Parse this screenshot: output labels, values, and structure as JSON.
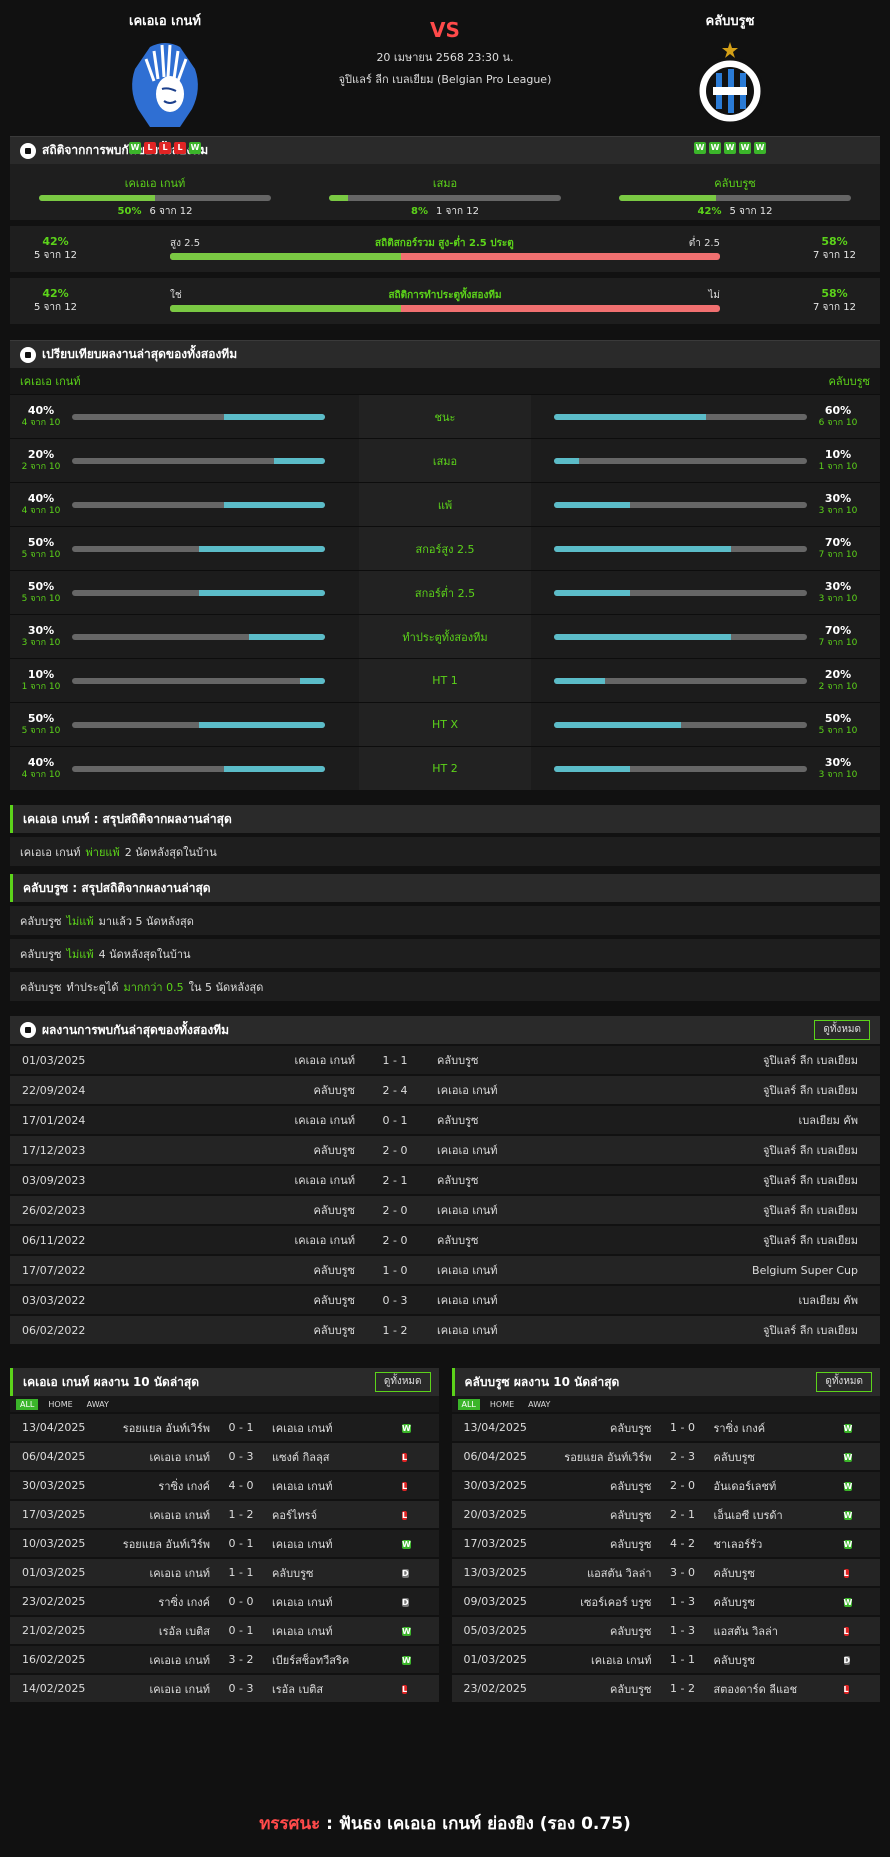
{
  "match": {
    "home": "เคเอเอ เกนท์",
    "away": "คลับบรูซ",
    "vs": "VS",
    "datetime": "20 เมษายน 2568 23:30 น.",
    "league": "จูปิแลร์ ลีก เบลเยียม (Belgian Pro League)",
    "home_form": [
      "W",
      "L",
      "L",
      "L",
      "W"
    ],
    "away_form": [
      "W",
      "W",
      "W",
      "W",
      "W"
    ]
  },
  "h2h_summary": {
    "title": "สถิติจากการพบกันของทั้งสองทีม",
    "items": [
      {
        "label": "เคเอเอ เกนท์",
        "pct": "50%",
        "count": "6 จาก 12",
        "fraction": 0.5
      },
      {
        "label": "เสมอ",
        "pct": "8%",
        "count": "1 จาก 12",
        "fraction": 0.08
      },
      {
        "label": "คลับบรูซ",
        "pct": "42%",
        "count": "5 จาก 12",
        "fraction": 0.42
      }
    ],
    "ou": {
      "left_pct": "42%",
      "left_count": "5 จาก 12",
      "over": "สูง 2.5",
      "title": "สถิติสกอร์รวม สูง-ต่ำ 2.5 ประตู",
      "under": "ต่ำ 2.5",
      "right_pct": "58%",
      "right_count": "7 จาก 12",
      "fraction": 0.42
    },
    "btts": {
      "left_pct": "42%",
      "left_count": "5 จาก 12",
      "yes": "ใช่",
      "title": "สถิติการทำประตูทั้งสองทีม",
      "no": "ไม่",
      "right_pct": "58%",
      "right_count": "7 จาก 12",
      "fraction": 0.42
    }
  },
  "compare": {
    "title": "เปรียบเทียบผลงานล่าสุดของทั้งสองทีม",
    "home": "เคเอเอ เกนท์",
    "away": "คลับบรูซ",
    "rows": [
      {
        "label": "ชนะ",
        "h_pct": "40%",
        "h_count": "4 จาก 10",
        "h": 0.4,
        "a_pct": "60%",
        "a_count": "6 จาก 10",
        "a": 0.6
      },
      {
        "label": "เสมอ",
        "h_pct": "20%",
        "h_count": "2 จาก 10",
        "h": 0.2,
        "a_pct": "10%",
        "a_count": "1 จาก 10",
        "a": 0.1
      },
      {
        "label": "แพ้",
        "h_pct": "40%",
        "h_count": "4 จาก 10",
        "h": 0.4,
        "a_pct": "30%",
        "a_count": "3 จาก 10",
        "a": 0.3
      },
      {
        "label": "สกอร์สูง 2.5",
        "h_pct": "50%",
        "h_count": "5 จาก 10",
        "h": 0.5,
        "a_pct": "70%",
        "a_count": "7 จาก 10",
        "a": 0.7
      },
      {
        "label": "สกอร์ต่ำ 2.5",
        "h_pct": "50%",
        "h_count": "5 จาก 10",
        "h": 0.5,
        "a_pct": "30%",
        "a_count": "3 จาก 10",
        "a": 0.3
      },
      {
        "label": "ทำประตูทั้งสองทีม",
        "h_pct": "30%",
        "h_count": "3 จาก 10",
        "h": 0.3,
        "a_pct": "70%",
        "a_count": "7 จาก 10",
        "a": 0.7
      },
      {
        "label": "HT 1",
        "h_pct": "10%",
        "h_count": "1 จาก 10",
        "h": 0.1,
        "a_pct": "20%",
        "a_count": "2 จาก 10",
        "a": 0.2
      },
      {
        "label": "HT X",
        "h_pct": "50%",
        "h_count": "5 จาก 10",
        "h": 0.5,
        "a_pct": "50%",
        "a_count": "5 จาก 10",
        "a": 0.5
      },
      {
        "label": "HT 2",
        "h_pct": "40%",
        "h_count": "4 จาก 10",
        "h": 0.4,
        "a_pct": "30%",
        "a_count": "3 จาก 10",
        "a": 0.3
      }
    ]
  },
  "home_summary": {
    "title": "เคเอเอ เกนท์ : สรุปสถิติจากผลงานล่าสุด",
    "lines": [
      {
        "team": "เคเอเอ เกนท์",
        "hl": "พ่ายแพ้",
        "rest": "2  นัดหลังสุดในบ้าน"
      }
    ]
  },
  "away_summary": {
    "title": "คลับบรูซ : สรุปสถิติจากผลงานล่าสุด",
    "lines": [
      {
        "team": "คลับบรูซ",
        "hl": "ไม่แพ้",
        "rest": "มาแล้ว 5 นัดหลังสุด"
      },
      {
        "team": "คลับบรูซ",
        "hl": "ไม่แพ้",
        "rest": "4  นัดหลังสุดในบ้าน"
      }
    ],
    "extra": {
      "team": "คลับบรูซ",
      "pre": "ทำประตูได้",
      "hl": "มากกว่า  0.5",
      "rest": "ใน 5 นัดหลังสุด"
    }
  },
  "h2h_list": {
    "title": "ผลงานการพบกันล่าสุดของทั้งสองทีม",
    "button": "ดูทั้งหมด",
    "rows": [
      {
        "date": "01/03/2025",
        "home": "เคเอเอ เกนท์",
        "score": "1 - 1",
        "away": "คลับบรูซ",
        "comp": "จูปิแลร์ ลีก เบลเยียม"
      },
      {
        "date": "22/09/2024",
        "home": "คลับบรูซ",
        "score": "2 - 4",
        "away": "เคเอเอ เกนท์",
        "comp": "จูปิแลร์ ลีก เบลเยียม"
      },
      {
        "date": "17/01/2024",
        "home": "เคเอเอ เกนท์",
        "score": "0 - 1",
        "away": "คลับบรูซ",
        "comp": "เบลเยียม คัพ"
      },
      {
        "date": "17/12/2023",
        "home": "คลับบรูซ",
        "score": "2 - 0",
        "away": "เคเอเอ เกนท์",
        "comp": "จูปิแลร์ ลีก เบลเยียม"
      },
      {
        "date": "03/09/2023",
        "home": "เคเอเอ เกนท์",
        "score": "2 - 1",
        "away": "คลับบรูซ",
        "comp": "จูปิแลร์ ลีก เบลเยียม"
      },
      {
        "date": "26/02/2023",
        "home": "คลับบรูซ",
        "score": "2 - 0",
        "away": "เคเอเอ เกนท์",
        "comp": "จูปิแลร์ ลีก เบลเยียม"
      },
      {
        "date": "06/11/2022",
        "home": "เคเอเอ เกนท์",
        "score": "2 - 0",
        "away": "คลับบรูซ",
        "comp": "จูปิแลร์ ลีก เบลเยียม"
      },
      {
        "date": "17/07/2022",
        "home": "คลับบรูซ",
        "score": "1 - 0",
        "away": "เคเอเอ เกนท์",
        "comp": "Belgium Super Cup"
      },
      {
        "date": "03/03/2022",
        "home": "คลับบรูซ",
        "score": "0 - 3",
        "away": "เคเอเอ เกนท์",
        "comp": "เบลเยียม คัพ"
      },
      {
        "date": "06/02/2022",
        "home": "คลับบรูซ",
        "score": "1 - 2",
        "away": "เคเอเอ เกนท์",
        "comp": "จูปิแลร์ ลีก เบลเยียม"
      }
    ]
  },
  "last10": {
    "tabs": [
      "ALL",
      "HOME",
      "AWAY"
    ],
    "button": "ดูทั้งหมด",
    "home": {
      "title": "เคเอเอ เกนท์ ผลงาน 10 นัดล่าสุด",
      "rows": [
        {
          "date": "13/04/2025",
          "home": "รอยแยล อันท์เวิร์พ",
          "score": "0 - 1",
          "away": "เคเอเอ เกนท์",
          "r": "W"
        },
        {
          "date": "06/04/2025",
          "home": "เคเอเอ เกนท์",
          "score": "0 - 3",
          "away": "แซงต์ กิลลุส",
          "r": "L"
        },
        {
          "date": "30/03/2025",
          "home": "ราซิ่ง เกงค์",
          "score": "4 - 0",
          "away": "เคเอเอ เกนท์",
          "r": "L"
        },
        {
          "date": "17/03/2025",
          "home": "เคเอเอ เกนท์",
          "score": "1 - 2",
          "away": "คอร์ไทรจ์",
          "r": "L"
        },
        {
          "date": "10/03/2025",
          "home": "รอยแยล อันท์เวิร์พ",
          "score": "0 - 1",
          "away": "เคเอเอ เกนท์",
          "r": "W"
        },
        {
          "date": "01/03/2025",
          "home": "เคเอเอ เกนท์",
          "score": "1 - 1",
          "away": "คลับบรูซ",
          "r": "D"
        },
        {
          "date": "23/02/2025",
          "home": "ราซิ่ง เกงค์",
          "score": "0 - 0",
          "away": "เคเอเอ เกนท์",
          "r": "D"
        },
        {
          "date": "21/02/2025",
          "home": "เรอัล เบติส",
          "score": "0 - 1",
          "away": "เคเอเอ เกนท์",
          "r": "W"
        },
        {
          "date": "16/02/2025",
          "home": "เคเอเอ เกนท์",
          "score": "3 - 2",
          "away": "เบียร์สช็อทวีสริค",
          "r": "W"
        },
        {
          "date": "14/02/2025",
          "home": "เคเอเอ เกนท์",
          "score": "0 - 3",
          "away": "เรอัล เบติส",
          "r": "L"
        }
      ]
    },
    "away": {
      "title": "คลับบรูซ ผลงาน 10 นัดล่าสุด",
      "rows": [
        {
          "date": "13/04/2025",
          "home": "คลับบรูซ",
          "score": "1 - 0",
          "away": "ราซิ่ง เกงค์",
          "r": "W"
        },
        {
          "date": "06/04/2025",
          "home": "รอยแยล อันท์เวิร์พ",
          "score": "2 - 3",
          "away": "คลับบรูซ",
          "r": "W"
        },
        {
          "date": "30/03/2025",
          "home": "คลับบรูซ",
          "score": "2 - 0",
          "away": "อันเดอร์เลชท์",
          "r": "W"
        },
        {
          "date": "20/03/2025",
          "home": "คลับบรูซ",
          "score": "2 - 1",
          "away": "เอ็นเอซี เบรด้า",
          "r": "W"
        },
        {
          "date": "17/03/2025",
          "home": "คลับบรูซ",
          "score": "4 - 2",
          "away": "ชาเลอร์รัว",
          "r": "W"
        },
        {
          "date": "13/03/2025",
          "home": "แอสตัน วิลล่า",
          "score": "3 - 0",
          "away": "คลับบรูซ",
          "r": "L"
        },
        {
          "date": "09/03/2025",
          "home": "เซอร์เคอร์ บรูซ",
          "score": "1 - 3",
          "away": "คลับบรูซ",
          "r": "W"
        },
        {
          "date": "05/03/2025",
          "home": "คลับบรูซ",
          "score": "1 - 3",
          "away": "แอสตัน วิลล่า",
          "r": "L"
        },
        {
          "date": "01/03/2025",
          "home": "เคเอเอ เกนท์",
          "score": "1 - 1",
          "away": "คลับบรูซ",
          "r": "D"
        },
        {
          "date": "23/02/2025",
          "home": "คลับบรูซ",
          "score": "1 - 2",
          "away": "สตองดาร์ด ลีแอช",
          "r": "L"
        }
      ]
    }
  },
  "verdict": {
    "label": "ทรรศนะ",
    "sep": ":",
    "text": "ฟันธง เคเอเอ เกนท์ ย่องยิง (รอง 0.75)"
  },
  "colors": {
    "accent": "#5cd31a",
    "bar_fill": "#5bbcc8",
    "win": "#3bb52a",
    "loss": "#e02424",
    "draw": "#777777"
  }
}
